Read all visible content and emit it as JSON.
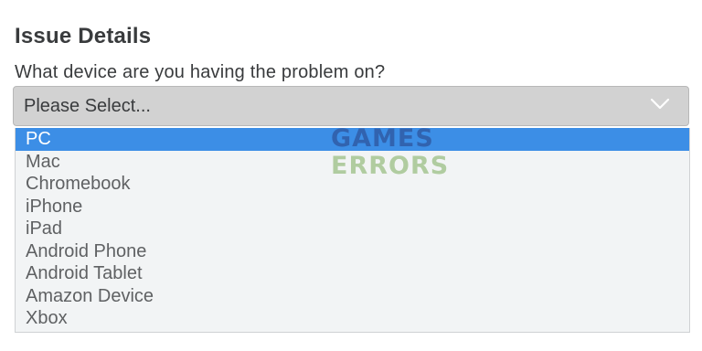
{
  "form": {
    "heading": "Issue Details",
    "question": "What device are you having the problem on?",
    "select": {
      "value": "Please Select...",
      "options": [
        "PC",
        "Mac",
        "Chromebook",
        "iPhone",
        "iPad",
        "Android Phone",
        "Android Tablet",
        "Amazon Device",
        "Xbox"
      ],
      "highlighted_option": "PC",
      "expand_icon": "chevron-down-icon"
    }
  },
  "watermark": {
    "line1": "GAMES",
    "line2": "ERRORS"
  },
  "colors": {
    "highlight": "#3c8ee6",
    "select_background": "#d2d2d2",
    "list_background": "#f2f4f5",
    "text": "#393b3d"
  }
}
